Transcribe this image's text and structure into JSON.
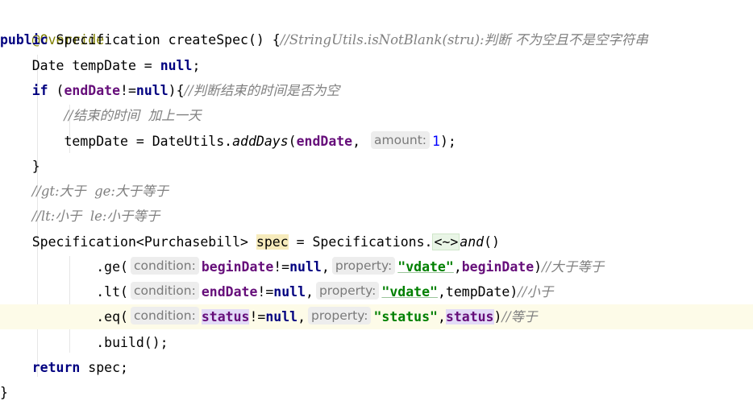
{
  "editor": {
    "lines": {
      "l1": {
        "annotation": "@Override"
      },
      "l2": {
        "kw_public": "public",
        "signature": " Specification createSpec() {",
        "comment": "//StringUtils.isNotBlank(stru):判断 不为空且不是空字符串"
      },
      "l3": {
        "pre": "    Date tempDate = ",
        "kw_null": "null",
        "post": ";"
      },
      "l4": {
        "pre": "    ",
        "kw_if": "if",
        "open": " (",
        "field": "endDate",
        "op": "!=",
        "kw_null": "null",
        "close": "){",
        "comment": "//判断结束的时间是否为空"
      },
      "l5": {
        "pre": "        ",
        "comment": "//结束的时间  加上一天"
      },
      "l6": {
        "pre": "        tempDate = DateUtils.",
        "method": "addDays",
        "open": "(",
        "field": "endDate",
        "comma": ", ",
        "hint": "amount:",
        "number": "1",
        "close": ");"
      },
      "l7": {
        "text": "    }"
      },
      "l8": {
        "pre": "    ",
        "comment": "//gt:大于  ge:大于等于"
      },
      "l9": {
        "pre": "    ",
        "comment": "//lt:小于  le:小于等于"
      },
      "l10": {
        "pre": "    Specification",
        "generic": "<Purchasebill>",
        "space": " ",
        "var": "spec",
        "mid": " = Specifications.",
        "diamond": "<~>",
        "method": "and",
        "close": "()"
      },
      "l11": {
        "pre": "            .ge(",
        "hint1": "condition:",
        "field": "beginDate",
        "op": "!=",
        "kw_null": "null",
        "comma1": ",",
        "hint2": "property:",
        "str": "\"vdate\"",
        "comma2": ",",
        "field2": "beginDate",
        "close": ")",
        "comment": "//大于等于"
      },
      "l12": {
        "pre": "            .lt(",
        "hint1": "condition:",
        "field": "endDate",
        "op": "!=",
        "kw_null": "null",
        "comma1": ",",
        "hint2": "property:",
        "str": "\"vdate\"",
        "rest": ",tempDate)",
        "comment": "//小于"
      },
      "l13": {
        "pre": "            .eq(",
        "hint1": "condition:",
        "field": "status",
        "op": "!=",
        "kw_null": "null",
        "comma1": ",",
        "hint2": "property:",
        "str": "\"status\"",
        "comma2": ",",
        "field2": "status",
        "close": ")",
        "comment": "//等于"
      },
      "l14": {
        "text": "            .build();"
      },
      "l15": {
        "pre": "    ",
        "kw_return": "return",
        "post": " spec;"
      },
      "l16": {
        "text": "}"
      }
    }
  },
  "colors": {
    "keyword": "#000080",
    "annotation": "#808000",
    "comment": "#808080",
    "field": "#660e7a",
    "string": "#008000",
    "number": "#0000ff",
    "current_line": "#fdfbe8"
  }
}
